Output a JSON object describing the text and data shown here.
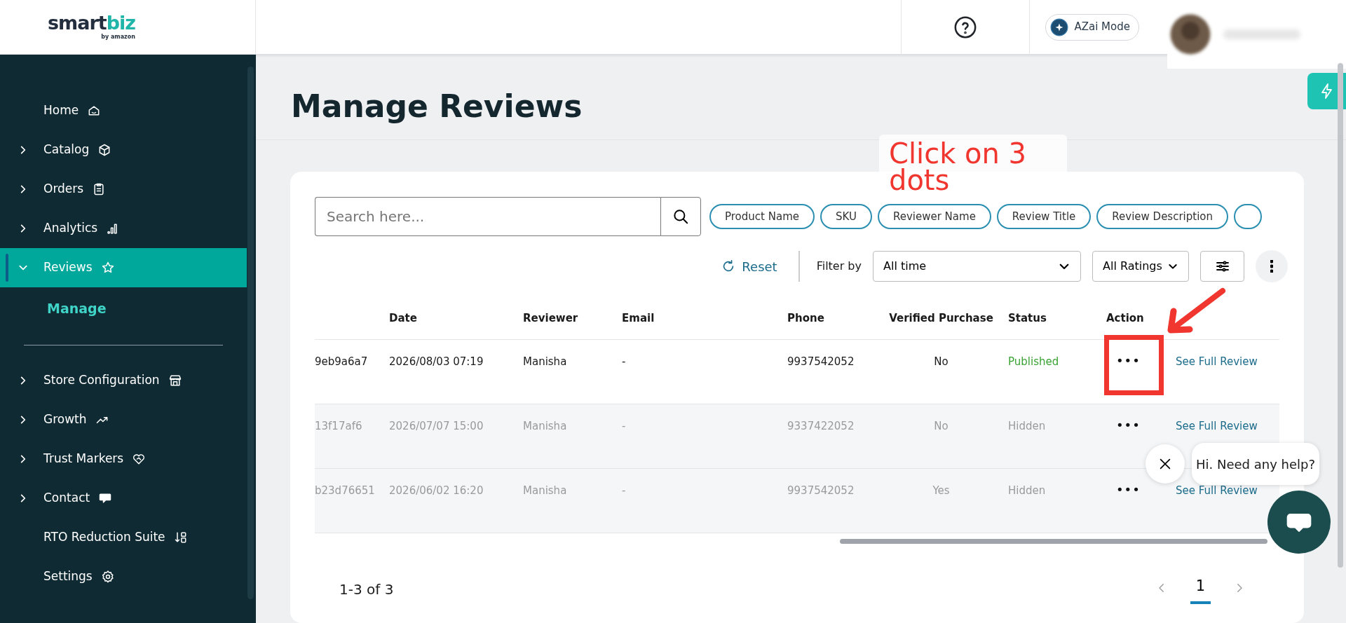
{
  "logo": {
    "main": "smart",
    "accent": "biz",
    "byline": "by amazon"
  },
  "header": {
    "azai_button": "AZai Mode"
  },
  "sidebar": {
    "groups": [
      [
        {
          "label": "Home",
          "expandable": false,
          "selected": false
        },
        {
          "label": "Catalog",
          "expandable": true,
          "expanded": false,
          "selected": false
        },
        {
          "label": "Orders",
          "expandable": true,
          "expanded": false,
          "selected": false
        },
        {
          "label": "Analytics",
          "expandable": true,
          "expanded": false,
          "selected": false
        },
        {
          "label": "Reviews",
          "expandable": true,
          "expanded": true,
          "selected": true,
          "children": [
            {
              "label": "Manage",
              "selected": true
            }
          ]
        }
      ],
      [
        {
          "label": "Store Configuration",
          "expandable": true,
          "expanded": false,
          "selected": false
        },
        {
          "label": "Growth",
          "expandable": true,
          "expanded": false,
          "selected": false
        },
        {
          "label": "Trust Markers",
          "expandable": true,
          "expanded": false,
          "selected": false
        },
        {
          "label": "Contact",
          "expandable": true,
          "expanded": false,
          "selected": false
        },
        {
          "label": "RTO Reduction Suite",
          "expandable": false,
          "selected": false
        },
        {
          "label": "Settings",
          "expandable": false,
          "selected": false
        }
      ]
    ]
  },
  "page": {
    "title": "Manage Reviews"
  },
  "search": {
    "placeholder": "Search here..."
  },
  "search_chips": [
    "Product Name",
    "SKU",
    "Reviewer Name",
    "Review Title",
    "Review Description"
  ],
  "filters": {
    "reset": "Reset",
    "filter_by": "Filter by",
    "time": "All time",
    "ratings": "All Ratings"
  },
  "table": {
    "columns": [
      "",
      "Date",
      "Reviewer",
      "Email",
      "Phone",
      "Verified Purchase",
      "Status",
      "Action",
      ""
    ],
    "rows": [
      {
        "column_1": "9eb9a6a7",
        "date": "2026/08/03 07:19",
        "reviewer": "Manisha",
        "email": "-",
        "phone": "9937542052",
        "verified_purchase": "No",
        "status": "Published",
        "published": true,
        "action": "•••",
        "link": "See Full Review"
      },
      {
        "column_1": "13f17af6",
        "date": "2026/07/07 15:00",
        "reviewer": "Manisha",
        "email": "-",
        "phone": "9337422052",
        "verified_purchase": "No",
        "status": "Hidden",
        "published": false,
        "action": "•••",
        "link": "See Full Review"
      },
      {
        "column_1": "b23d76651",
        "date": "2026/06/02 16:20",
        "reviewer": "Manisha",
        "email": "-",
        "phone": "9937542052",
        "verified_purchase": "Yes",
        "status": "Hidden",
        "published": false,
        "action": "•••",
        "link": "See Full Review"
      }
    ]
  },
  "pagination": {
    "summary": "1-3 of 3",
    "pages": [
      {
        "label": "1",
        "selected": true
      }
    ]
  },
  "annotation": {
    "text": "Click on 3 dots"
  },
  "chat": {
    "greeting": "Hi. Need any help?"
  }
}
